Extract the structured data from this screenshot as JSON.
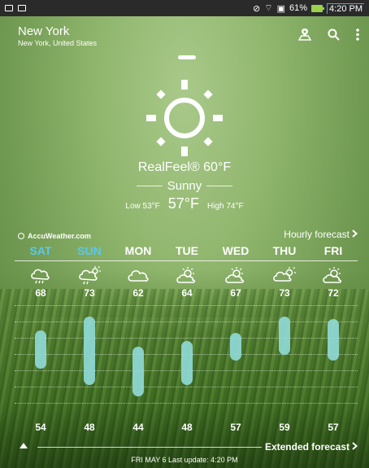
{
  "status_bar": {
    "battery": "61%",
    "time": "4:20 PM"
  },
  "location": {
    "city": "New York",
    "region": "New York, United States"
  },
  "current": {
    "realfeel": "RealFeel® 60°F",
    "condition": "Sunny",
    "low": "Low 53°F",
    "now": "57°F",
    "high": "High 74°F",
    "icon": "sun-icon"
  },
  "links": {
    "accuweather": "AccuWeather.com",
    "hourly": "Hourly forecast",
    "extended": "Extended forecast",
    "footer": "FRI MAY 6 Last update: 4:20 PM"
  },
  "colors": {
    "accent_day": "#5ac8f0",
    "bar": "#8fd9d6",
    "statusbar": "#2a2a2a"
  },
  "forecast": [
    {
      "day": "SAT",
      "high": 68,
      "low": 54,
      "icon": "rain-cloud-icon",
      "highlight": true
    },
    {
      "day": "SUN",
      "high": 73,
      "low": 48,
      "icon": "sun-rain-cloud-icon",
      "highlight": true
    },
    {
      "day": "MON",
      "high": 62,
      "low": 44,
      "icon": "cloud-icon",
      "highlight": false
    },
    {
      "day": "TUE",
      "high": 64,
      "low": 48,
      "icon": "partly-sunny-icon",
      "highlight": false
    },
    {
      "day": "WED",
      "high": 67,
      "low": 57,
      "icon": "partly-sunny-icon",
      "highlight": false
    },
    {
      "day": "THU",
      "high": 73,
      "low": 59,
      "icon": "partly-cloudy-sun-icon",
      "highlight": false
    },
    {
      "day": "FRI",
      "high": 72,
      "low": 57,
      "icon": "partly-sunny-icon",
      "highlight": false
    }
  ]
}
